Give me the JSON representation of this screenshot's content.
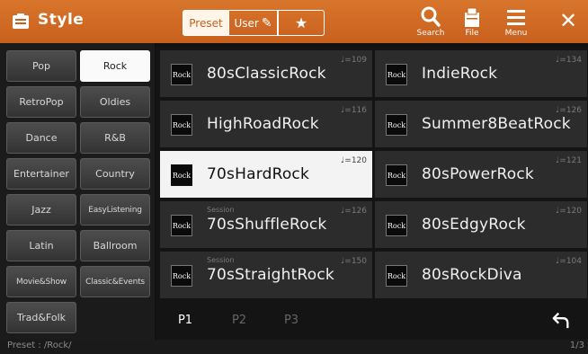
{
  "header": {
    "title": "Style",
    "tabs": {
      "preset": "Preset",
      "user": "User"
    },
    "buttons": {
      "search": "Search",
      "file": "File",
      "menu": "Menu"
    }
  },
  "categories": [
    "Pop",
    "Rock",
    "RetroPop",
    "Oldies",
    "Dance",
    "R&B",
    "Entertainer",
    "Country",
    "Jazz",
    "EasyListening",
    "Latin",
    "Ballroom",
    "Movie&Show",
    "Classic&Events",
    "Trad&Folk"
  ],
  "selected_category": "Rock",
  "styles": [
    {
      "name": "80sClassicRock",
      "tempo": "♩=109",
      "sublabel": ""
    },
    {
      "name": "IndieRock",
      "tempo": "♩=134",
      "sublabel": ""
    },
    {
      "name": "HighRoadRock",
      "tempo": "♩=116",
      "sublabel": ""
    },
    {
      "name": "Summer8BeatRock",
      "tempo": "♩=126",
      "sublabel": ""
    },
    {
      "name": "70sHardRock",
      "tempo": "♩=120",
      "sublabel": ""
    },
    {
      "name": "80sPowerRock",
      "tempo": "♩=121",
      "sublabel": ""
    },
    {
      "name": "70sShuffleRock",
      "tempo": "♩=126",
      "sublabel": "Session"
    },
    {
      "name": "80sEdgyRock",
      "tempo": "♩=120",
      "sublabel": ""
    },
    {
      "name": "70sStraightRock",
      "tempo": "♩=150",
      "sublabel": "Session"
    },
    {
      "name": "80sRockDiva",
      "tempo": "♩=104",
      "sublabel": ""
    }
  ],
  "style_icon_label": "Rock",
  "selected_style": "70sHardRock",
  "pages": [
    "P1",
    "P2",
    "P3"
  ],
  "current_page": "P1",
  "status": {
    "path": "Preset : /Rock/",
    "page_count": "1/3"
  },
  "colors": {
    "header": "#c8601d",
    "selected": "#f3f3f3",
    "item": "#2c2c2c"
  },
  "icons": {
    "app": "style-icon",
    "search": "search-icon",
    "file": "file-icon",
    "menu": "menu-icon",
    "close": "close-icon",
    "back": "back-arrow-icon",
    "favorite": "star-icon",
    "user_edit": "pencil-icon"
  }
}
